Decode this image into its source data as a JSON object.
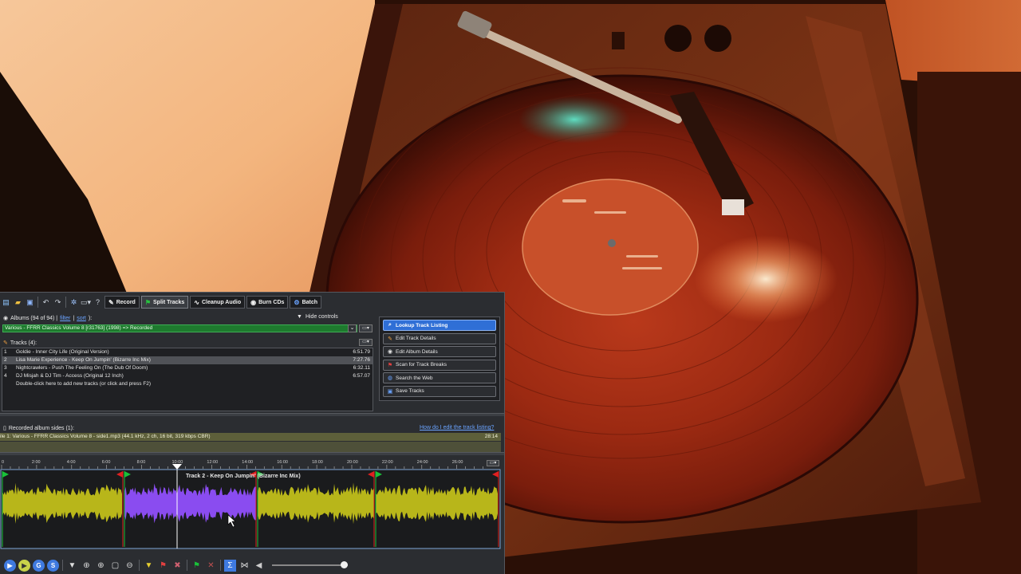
{
  "toolbar": {
    "tabs": [
      {
        "label": "Record",
        "icon": "microphone-icon"
      },
      {
        "label": "Split Tracks",
        "icon": "split-icon"
      },
      {
        "label": "Cleanup Audio",
        "icon": "waveform-icon"
      },
      {
        "label": "Burn CDs",
        "icon": "disc-icon"
      },
      {
        "label": "Batch",
        "icon": "batch-icon"
      }
    ],
    "active_tab": "Split Tracks"
  },
  "albums": {
    "label": "Albums (94 of 94) |",
    "filter_link": "filter",
    "separator": "|",
    "sort_link": "sort",
    "suffix": "):",
    "selected": "Various - FFRR Classics Volume 8 [r31763] (1998) => Recorded",
    "hide_controls": "Hide controls"
  },
  "tracks": {
    "label": "Tracks (4):",
    "rows": [
      {
        "num": "1",
        "title": "Goldie - Inner City Life (Original Version)",
        "duration": "6:51.79"
      },
      {
        "num": "2",
        "title": "Lisa Marie Experience - Keep On Jumpin' (Bizarre Inc Mix)",
        "duration": "7:27.76"
      },
      {
        "num": "3",
        "title": "Nightcrawlers - Push The Feeling On (The Dub Of Doom)",
        "duration": "6:32.11"
      },
      {
        "num": "4",
        "title": "DJ Misjah & DJ Tim - Access (Original 12 Inch)",
        "duration": "6:57.07"
      }
    ],
    "add_hint": "Double-click here to add new tracks (or click and press F2)",
    "selected_index": 1
  },
  "actions": [
    {
      "label": "Lookup Track Listing",
      "icon": "search-icon",
      "primary": true
    },
    {
      "label": "Edit Track Details",
      "icon": "pencil-icon",
      "primary": false
    },
    {
      "label": "Edit Album Details",
      "icon": "disc-icon",
      "primary": false
    },
    {
      "label": "Scan for Track Breaks",
      "icon": "scan-icon",
      "primary": false
    },
    {
      "label": "Search the Web",
      "icon": "globe-icon",
      "primary": false
    },
    {
      "label": "Save Tracks",
      "icon": "save-icon",
      "primary": false
    }
  ],
  "recorded": {
    "label": "Recorded album sides (1):",
    "help_link": "How do I edit the track listing?",
    "file": "ile 1: Various - FFRR Classics Volume 8 - side1.mp3 (44.1 kHz, 2 ch, 16 bit, 319 kbps CBR)",
    "length": "28:14"
  },
  "timeline": {
    "ticks": [
      "0",
      "2:00",
      "4:00",
      "6:00",
      "8:00",
      "10:00",
      "12:00",
      "14:00",
      "16:00",
      "18:00",
      "20:00",
      "22:00",
      "24:00",
      "26:00"
    ],
    "current_track_label": "Track 2 - Keep On Jumpin' (Bizarre Inc Mix)"
  },
  "colors": {
    "wave_normal": "#b8b61a",
    "wave_selected": "#8a4cf0",
    "start_marker": "#19c139",
    "end_marker": "#e02020",
    "primary_button": "#2f6fd6"
  }
}
